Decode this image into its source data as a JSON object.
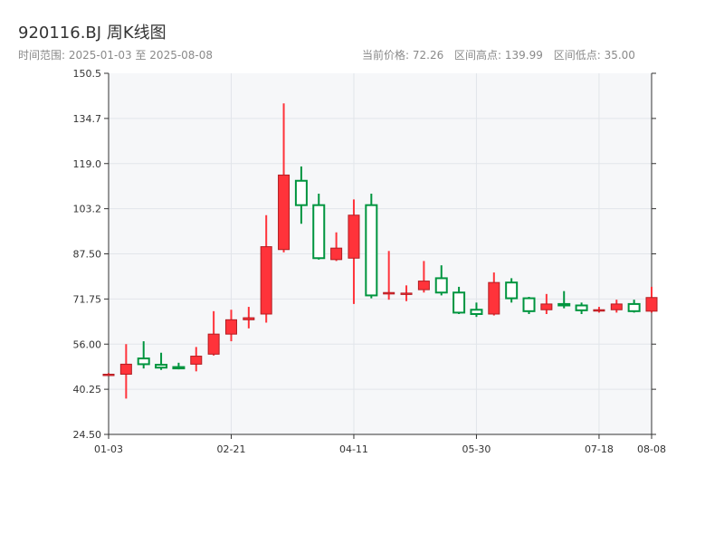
{
  "header": {
    "title": "920116.BJ 周K线图",
    "range_label": "时间范围:",
    "range_start": "2025-01-03",
    "range_sep": "至",
    "range_end": "2025-08-08",
    "current_price": "当前价格: 72.26",
    "range_high": "区间高点: 139.99",
    "range_low": "区间低点: 35.00"
  },
  "colors": {
    "up": "#ff333a",
    "down": "#00953f",
    "plot_bg": "#f6f7f9",
    "grid": "#e2e5ea",
    "axis": "#333333"
  },
  "chart_data": {
    "type": "candlestick",
    "ylim": [
      24.5,
      150.5
    ],
    "y_ticks": [
      "150.5",
      "134.7",
      "119.0",
      "103.2",
      "87.50",
      "71.75",
      "56.00",
      "40.25",
      "24.50"
    ],
    "x_ticks": [
      {
        "label": "01-03",
        "index": 0
      },
      {
        "label": "02-21",
        "index": 7
      },
      {
        "label": "04-11",
        "index": 14
      },
      {
        "label": "05-30",
        "index": 21
      },
      {
        "label": "07-18",
        "index": 28
      },
      {
        "label": "08-08",
        "index": 31
      }
    ],
    "grid": true,
    "candles": [
      {
        "o": 45.5,
        "c": 45.5,
        "h": 45.9,
        "l": 45.1
      },
      {
        "o": 45.5,
        "c": 49.0,
        "h": 56.0,
        "l": 37.0
      },
      {
        "o": 51.0,
        "c": 49.0,
        "h": 57.0,
        "l": 47.5
      },
      {
        "o": 48.8,
        "c": 47.8,
        "h": 53.0,
        "l": 47.0
      },
      {
        "o": 48.0,
        "c": 47.8,
        "h": 49.5,
        "l": 47.2
      },
      {
        "o": 49.0,
        "c": 51.8,
        "h": 55.0,
        "l": 46.5
      },
      {
        "o": 52.5,
        "c": 59.5,
        "h": 67.5,
        "l": 52.0
      },
      {
        "o": 59.5,
        "c": 64.5,
        "h": 68.0,
        "l": 57.0
      },
      {
        "o": 64.5,
        "c": 65.2,
        "h": 69.0,
        "l": 61.5
      },
      {
        "o": 66.5,
        "c": 90.0,
        "h": 101.0,
        "l": 63.5
      },
      {
        "o": 89.0,
        "c": 115.0,
        "h": 139.99,
        "l": 88.0
      },
      {
        "o": 113.0,
        "c": 104.5,
        "h": 118.0,
        "l": 98.0
      },
      {
        "o": 104.5,
        "c": 86.0,
        "h": 108.5,
        "l": 85.5
      },
      {
        "o": 85.5,
        "c": 89.5,
        "h": 95.0,
        "l": 85.0
      },
      {
        "o": 86.0,
        "c": 101.0,
        "h": 106.5,
        "l": 70.0
      },
      {
        "o": 104.5,
        "c": 73.0,
        "h": 108.5,
        "l": 72.0
      },
      {
        "o": 73.5,
        "c": 74.0,
        "h": 88.5,
        "l": 71.5
      },
      {
        "o": 73.5,
        "c": 73.8,
        "h": 76.5,
        "l": 71.0
      },
      {
        "o": 75.0,
        "c": 78.0,
        "h": 85.0,
        "l": 74.0
      },
      {
        "o": 79.0,
        "c": 74.0,
        "h": 83.5,
        "l": 73.0
      },
      {
        "o": 74.0,
        "c": 67.0,
        "h": 76.0,
        "l": 66.5
      },
      {
        "o": 68.0,
        "c": 66.5,
        "h": 70.5,
        "l": 65.5
      },
      {
        "o": 66.5,
        "c": 77.5,
        "h": 81.0,
        "l": 66.0
      },
      {
        "o": 77.5,
        "c": 72.0,
        "h": 79.0,
        "l": 70.5
      },
      {
        "o": 72.0,
        "c": 67.5,
        "h": 72.5,
        "l": 66.5
      },
      {
        "o": 68.0,
        "c": 70.0,
        "h": 73.5,
        "l": 66.5
      },
      {
        "o": 70.0,
        "c": 69.5,
        "h": 74.5,
        "l": 68.5
      },
      {
        "o": 69.5,
        "c": 67.8,
        "h": 70.5,
        "l": 66.5
      },
      {
        "o": 67.8,
        "c": 68.0,
        "h": 69.0,
        "l": 67.0
      },
      {
        "o": 68.0,
        "c": 70.0,
        "h": 71.5,
        "l": 67.0
      },
      {
        "o": 70.0,
        "c": 67.5,
        "h": 71.5,
        "l": 67.0
      },
      {
        "o": 67.5,
        "c": 72.26,
        "h": 76.0,
        "l": 67.0
      }
    ]
  }
}
